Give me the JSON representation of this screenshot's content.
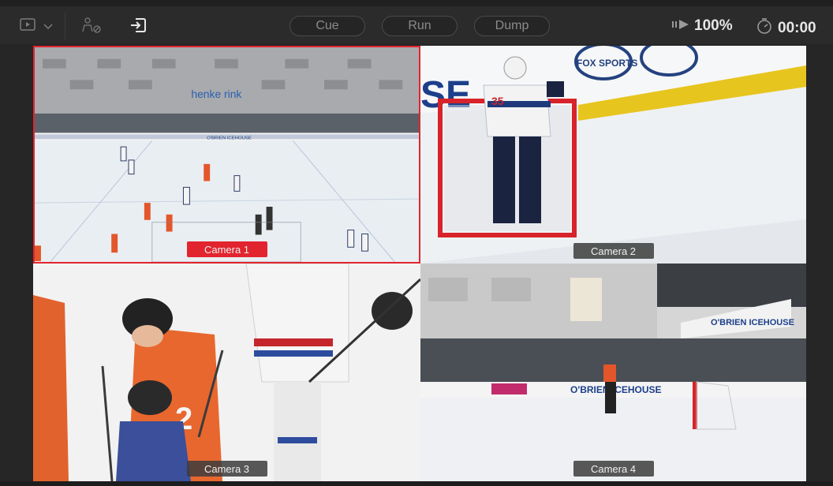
{
  "toolbar": {
    "monitor_icon": "monitor-play-icon",
    "dropdown_icon": "chevron-down-icon",
    "camera_off_icon": "camera-disabled-icon",
    "exit_icon": "exit-arrow-icon",
    "cue_label": "Cue",
    "run_label": "Run",
    "dump_label": "Dump",
    "speed_value": "100%",
    "timer_value": "00:00"
  },
  "cameras": [
    {
      "label": "Camera 1",
      "active": true
    },
    {
      "label": "Camera 2",
      "active": false
    },
    {
      "label": "Camera 3",
      "active": false
    },
    {
      "label": "Camera 4",
      "active": false
    }
  ],
  "scene_text": {
    "rink_sign": "henke rink",
    "board_text_1": "O'BRIEN ICEHOUSE",
    "fox_logo": "FOX SPORTS",
    "banner_text": "O'BRIEN ICEHOUSE",
    "board_text_4": "O'BRIEN ICEHOUSE",
    "jersey_number": "35",
    "wall_letters": "SE"
  },
  "colors": {
    "accent_red": "#e2242f",
    "background": "#262626"
  }
}
